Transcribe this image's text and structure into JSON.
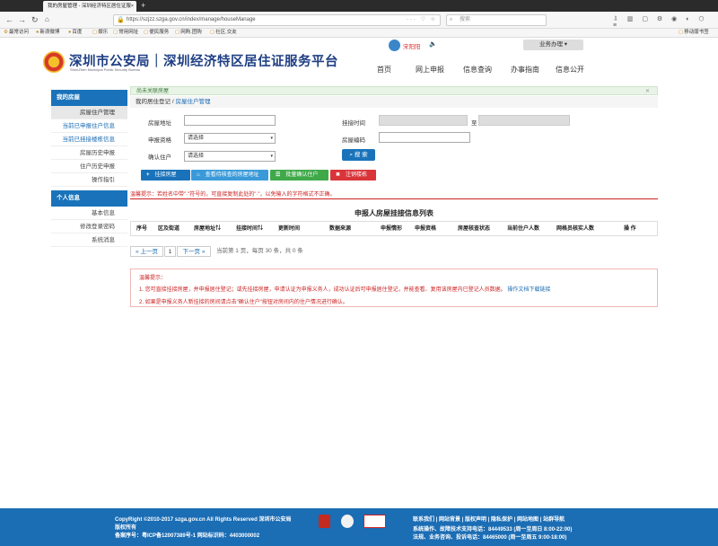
{
  "browser": {
    "tab_title": "我的房屋管理 - 深圳经济特区居住证服",
    "url": "https://szjzz.szga.gov.cn/index/manage/houseManage",
    "search_placeholder": "搜索",
    "bookmarks": [
      "最常访问",
      "新浪微博",
      "百度",
      "娱乐",
      "常用网址",
      "便民服务",
      "网购.团购",
      "社区.交友"
    ],
    "mobile_bookmarks": "移动版书签"
  },
  "header": {
    "site_name": "深圳市公安局｜深圳经济特区居住证服务平台",
    "site_name_en": "ShenZhen Municipal Public Security Bureau",
    "user_name": "宋阳阳",
    "business_btn": "业务办理",
    "nav": [
      "首页",
      "网上申报",
      "信息查询",
      "办事指南",
      "信息公开"
    ]
  },
  "sidebar": {
    "sec1": "我的房屋",
    "items1": [
      "房屋住户管理",
      "当前已申报住户信息",
      "当前已挂接楼栋信息",
      "房屋历史申报",
      "住户历史申报",
      "操作指引"
    ],
    "sec2": "个人信息",
    "items2": [
      "基本信息",
      "修改登录密码",
      "系统消息"
    ]
  },
  "notice": "尚未关联房屋",
  "breadcrumb": {
    "root": "我的居住登记",
    "sep": "/",
    "current": "房屋住户管理"
  },
  "form": {
    "house_addr": "房屋地址",
    "link_time": "挂接时间",
    "to": "至",
    "qualification": "申报资格",
    "house_code": "房屋编码",
    "confirm": "确认住户",
    "select_ph": "请选择",
    "search": "搜 索"
  },
  "actions": [
    {
      "label": "挂接房屋",
      "icon": "+"
    },
    {
      "label": "查看待核查的房屋地址",
      "icon": "⌂"
    },
    {
      "label": "批量确认住户",
      "icon": "☰"
    },
    {
      "label": "注销楼栋",
      "icon": "✖"
    }
  ],
  "warning": "温馨提示：若姓名中带\"·\"符号的，可直接复制此处的\"·\"，以免输入的字符格式不正确。",
  "table": {
    "title": "申报人房屋挂接信息列表",
    "headers": [
      "序号",
      "区及街道",
      "房屋地址⇅",
      "挂接时间⇅",
      "更新时间",
      "数据来源",
      "申报情形",
      "申报资格",
      "房屋核查状态",
      "当前住户人数",
      "网格员核实人数",
      "操  作"
    ]
  },
  "pager": {
    "prev": "« 上一页",
    "page": "1",
    "next": "下一页 »",
    "info": "当前第 1 页，每页 30 条，共 0 条"
  },
  "tips": {
    "title": "温馨提示：",
    "line1": "1. 您可直接挂接房屋，并申报居住登记；或先挂接房屋，申请认证为申报义务人，成功认证后可申报居住登记，并能查看、复用该房屋内已登记人员数据。",
    "link": "操作文档下载链接",
    "line2": "2. 如果是申报义务人新挂接的房间请点击\"确认住户\"按钮对房间内的住户情况进行确认。"
  },
  "footer": {
    "copyright": "CopyRight ©2010-2017 szga.gov.cn All Rights Reserved 深圳市公安局",
    "rights": "版权所有",
    "icp": "备案序号：粤ICP备12007389号-1  网站标识码：4403000002",
    "links": "联系我们 | 网站背景 | 版权声明 | 隐私保护 | 网站地图 | 站群导航",
    "support": "系统操作、故障技术支持电话：84449533 (周一至周日 8:00-22:00)",
    "consult": "法规、业务咨询、投诉电话：84465000 (周一至周五 9:00-18:00)"
  }
}
